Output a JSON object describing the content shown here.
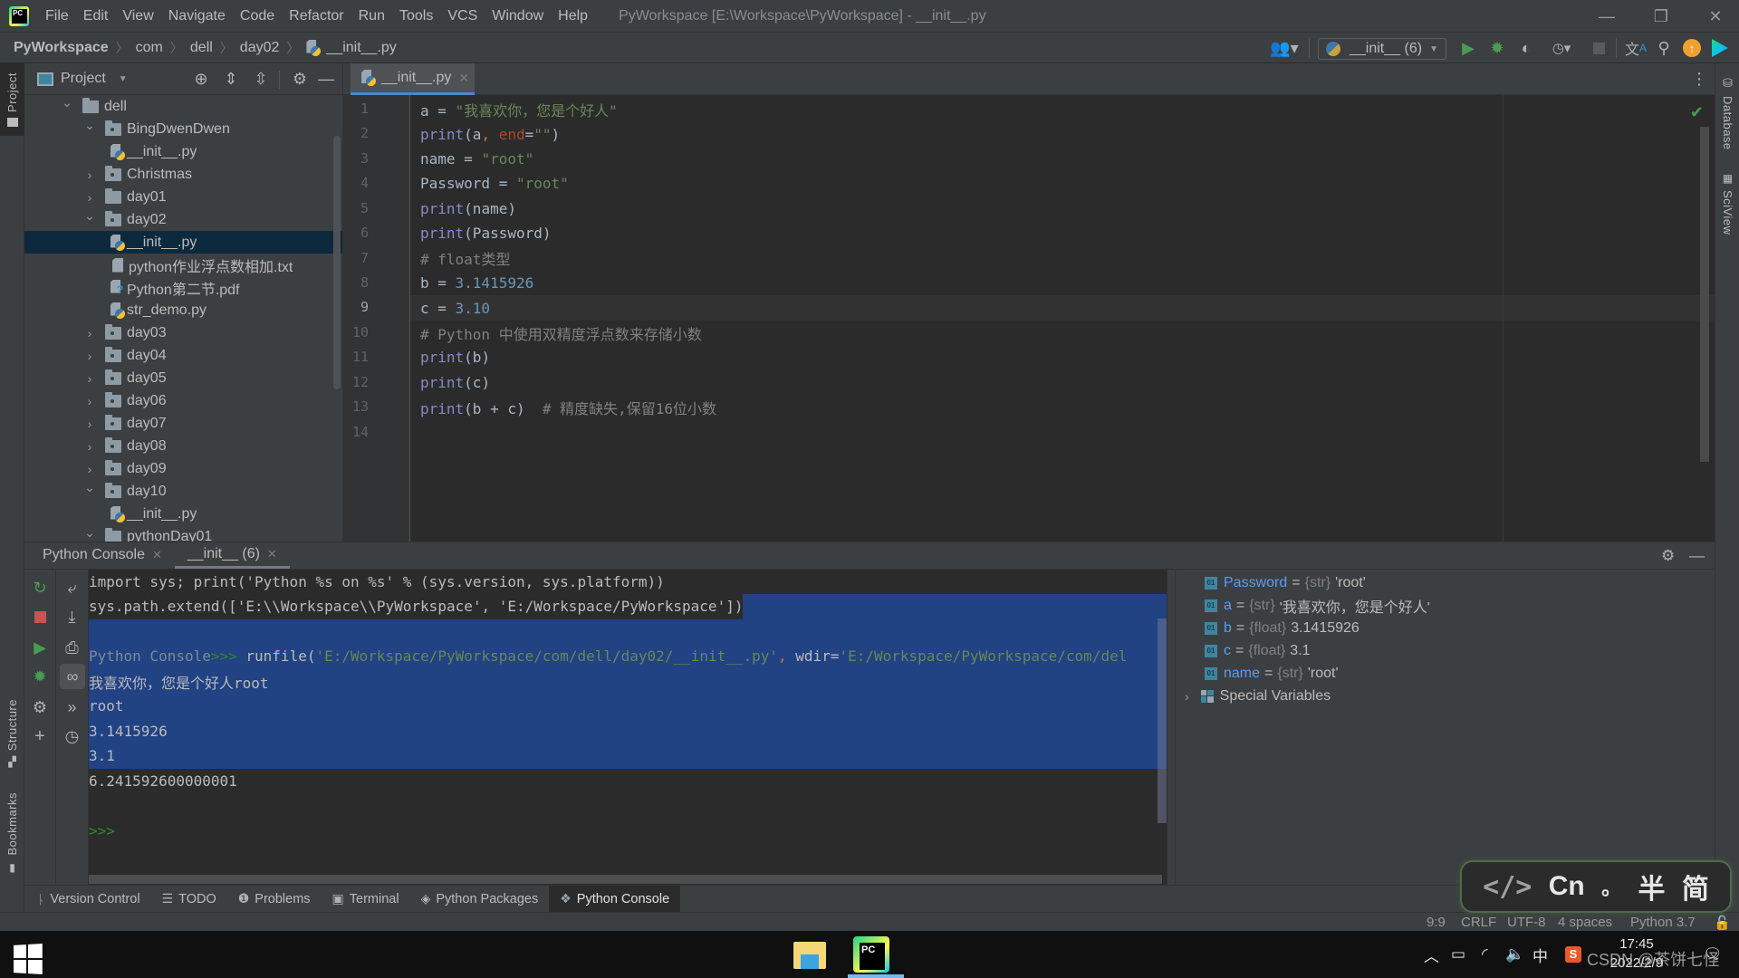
{
  "menu": {
    "items": [
      "File",
      "Edit",
      "View",
      "Navigate",
      "Code",
      "Refactor",
      "Run",
      "Tools",
      "VCS",
      "Window",
      "Help"
    ],
    "window_title": "PyWorkspace [E:\\Workspace\\PyWorkspace] - __init__.py"
  },
  "window_controls": {
    "minimize": "—",
    "restore": "❐",
    "close": "✕"
  },
  "breadcrumb": {
    "items": [
      "PyWorkspace",
      "com",
      "dell",
      "day02",
      "__init__.py"
    ]
  },
  "toolbar": {
    "run_config": "__init__ (6)",
    "icons": [
      "vcs-user-icon",
      "run-icon",
      "debug-icon",
      "coverage-icon",
      "profile-icon",
      "stop-icon",
      "translate-icon",
      "search-icon",
      "update-icon",
      "toolbox-icon"
    ]
  },
  "left_stripe": {
    "project": "Project",
    "structure": "Structure",
    "bookmarks": "Bookmarks"
  },
  "right_stripe": {
    "database": "Database",
    "sciview": "SciView"
  },
  "project_panel": {
    "title": "Project",
    "tree": [
      {
        "label": "dell",
        "type": "folder",
        "depth": 0,
        "expanded": true
      },
      {
        "label": "BingDwenDwen",
        "type": "package",
        "depth": 1,
        "expanded": true
      },
      {
        "label": "__init__.py",
        "type": "py",
        "depth": 2
      },
      {
        "label": "Christmas",
        "type": "package",
        "depth": 1,
        "expanded": false
      },
      {
        "label": "day01",
        "type": "folder",
        "depth": 1,
        "expanded": false
      },
      {
        "label": "day02",
        "type": "package",
        "depth": 1,
        "expanded": true
      },
      {
        "label": "__init__.py",
        "type": "py",
        "depth": 2,
        "selected": true
      },
      {
        "label": "python作业浮点数相加.txt",
        "type": "txt",
        "depth": 2
      },
      {
        "label": "Python第二节.pdf",
        "type": "pdf",
        "depth": 2
      },
      {
        "label": "str_demo.py",
        "type": "py",
        "depth": 2
      },
      {
        "label": "day03",
        "type": "package",
        "depth": 1,
        "expanded": false
      },
      {
        "label": "day04",
        "type": "package",
        "depth": 1,
        "expanded": false
      },
      {
        "label": "day05",
        "type": "package",
        "depth": 1,
        "expanded": false
      },
      {
        "label": "day06",
        "type": "package",
        "depth": 1,
        "expanded": false
      },
      {
        "label": "day07",
        "type": "package",
        "depth": 1,
        "expanded": false
      },
      {
        "label": "day08",
        "type": "package",
        "depth": 1,
        "expanded": false
      },
      {
        "label": "day09",
        "type": "package",
        "depth": 1,
        "expanded": false
      },
      {
        "label": "day10",
        "type": "package",
        "depth": 1,
        "expanded": true
      },
      {
        "label": "__init__.py",
        "type": "py",
        "depth": 2
      },
      {
        "label": "pythonDay01",
        "type": "folder",
        "depth": 1,
        "expanded": true
      }
    ]
  },
  "editor": {
    "tab_label": "__init__.py",
    "current_line": 9,
    "lines": [
      [
        [
          "a = ",
          ""
        ],
        [
          "\"我喜欢你，您是个好人\"",
          "str"
        ]
      ],
      [
        [
          "print",
          "fn"
        ],
        [
          "(a",
          ""
        ],
        [
          ", ",
          "punc"
        ],
        [
          "end",
          "kw"
        ],
        [
          "=",
          ""
        ],
        [
          "\"\"",
          "str"
        ],
        [
          ")",
          ""
        ]
      ],
      [
        [
          "name = ",
          ""
        ],
        [
          "\"root\"",
          "str"
        ]
      ],
      [
        [
          "Password = ",
          ""
        ],
        [
          "\"root\"",
          "str"
        ]
      ],
      [
        [
          "print",
          "fn"
        ],
        [
          "(name)",
          ""
        ]
      ],
      [
        [
          "print",
          "fn"
        ],
        [
          "(Password)",
          ""
        ]
      ],
      [
        [
          "# float类型",
          "cmt"
        ]
      ],
      [
        [
          "b = ",
          ""
        ],
        [
          "3.1415926",
          "num"
        ]
      ],
      [
        [
          "c = ",
          ""
        ],
        [
          "3.10",
          "num"
        ]
      ],
      [
        [
          "# Python 中使用双精度浮点数来存储小数",
          "cmt"
        ]
      ],
      [
        [
          "print",
          "fn"
        ],
        [
          "(b)",
          ""
        ]
      ],
      [
        [
          "print",
          "fn"
        ],
        [
          "(c)",
          ""
        ]
      ],
      [
        [
          "print",
          "fn"
        ],
        [
          "(b + c)  ",
          ""
        ],
        [
          "# 精度缺失,保留16位小数",
          "cmt"
        ]
      ],
      []
    ]
  },
  "console": {
    "tabs": [
      {
        "label": "Python Console",
        "active": false
      },
      {
        "label": "__init__ (6)",
        "active": true
      }
    ],
    "output": {
      "line1": "import sys; print('Python %s on %s' % (sys.version, sys.platform))",
      "line2": "sys.path.extend(['E:\\\\Workspace\\\\PyWorkspace', 'E:/Workspace/PyWorkspace'])",
      "prompt_label": "Python Console",
      "prompt": ">>>",
      "runfile_cmd": " runfile(",
      "runfile_path": "'E:/Workspace/PyWorkspace/com/dell/day02/__init__.py'",
      "runfile_sep": ",",
      "runfile_wdir": " wdir=",
      "runfile_wdir_val": "'E:/Workspace/PyWorkspace/com/del",
      "results": [
        "我喜欢你，您是个好人root",
        "root",
        "3.1415926",
        "3.1",
        "6.241592600000001"
      ],
      "input_prompt": ">>>"
    },
    "variables": [
      {
        "name": "Password",
        "type": "{str}",
        "value": "'root'"
      },
      {
        "name": "a",
        "type": "{str}",
        "value": "'我喜欢你，您是个好人'"
      },
      {
        "name": "b",
        "type": "{float}",
        "value": "3.1415926"
      },
      {
        "name": "c",
        "type": "{float}",
        "value": "3.1"
      },
      {
        "name": "name",
        "type": "{str}",
        "value": "'root'"
      }
    ],
    "special_variables": "Special Variables",
    "var_badge": "01"
  },
  "tool_windows": [
    {
      "label": "Version Control",
      "icon": "branch-icon",
      "active": false
    },
    {
      "label": "TODO",
      "icon": "list-icon",
      "active": false
    },
    {
      "label": "Problems",
      "icon": "problems-icon",
      "active": false
    },
    {
      "label": "Terminal",
      "icon": "terminal-icon",
      "active": false
    },
    {
      "label": "Python Packages",
      "icon": "packages-icon",
      "active": false
    },
    {
      "label": "Python Console",
      "icon": "python-icon",
      "active": true
    }
  ],
  "status_bar": {
    "position": "9:9",
    "line_sep": "CRLF",
    "encoding": "UTF-8",
    "indent": "4 spaces",
    "interpreter": "Python 3.7"
  },
  "ime": {
    "mode": "Cn",
    "punct": "。",
    "width": "半",
    "script": "简",
    "code": "</>"
  },
  "taskbar": {
    "time": "17:45",
    "date": "2022/2/9",
    "ime_lang": "中",
    "watermark": "CSDN @茶饼七怪"
  }
}
